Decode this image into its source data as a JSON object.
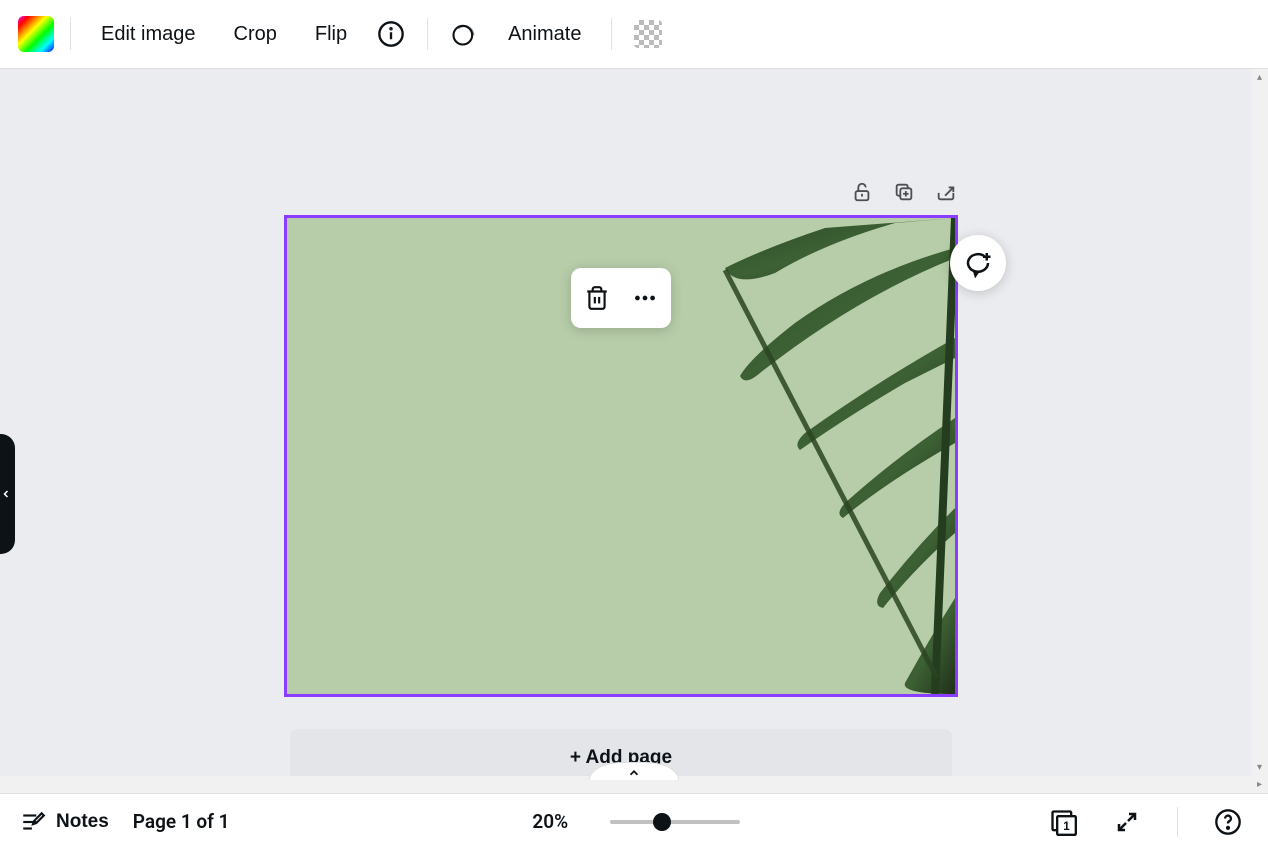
{
  "toolbar": {
    "edit_image_label": "Edit image",
    "crop_label": "Crop",
    "flip_label": "Flip",
    "animate_label": "Animate"
  },
  "canvas": {
    "add_page_label": "+ Add page",
    "selected_border_color": "#8b3dff",
    "background_color": "#b7cda9"
  },
  "footer": {
    "notes_label": "Notes",
    "page_label": "Page 1 of 1",
    "zoom_label": "20%",
    "grid_page_number": "1"
  }
}
